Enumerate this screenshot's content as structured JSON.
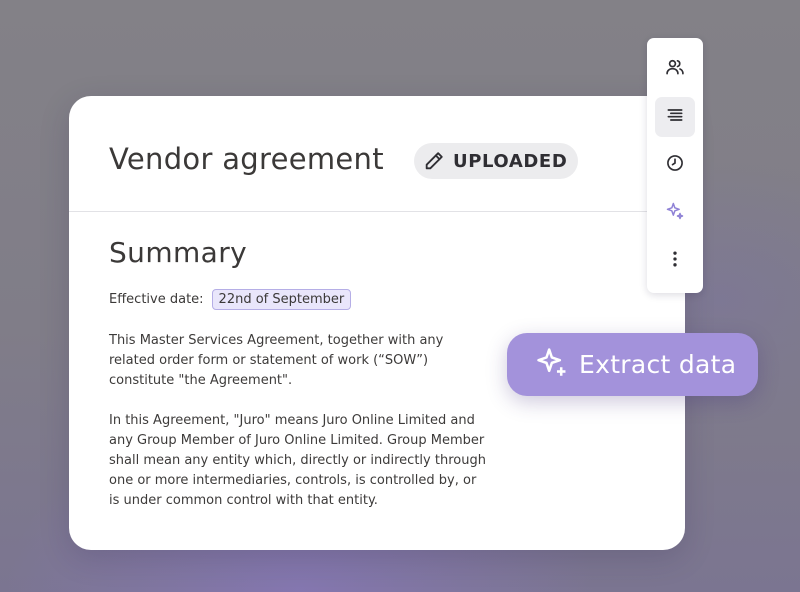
{
  "document": {
    "title": "Vendor agreement",
    "status": "UPLOADED",
    "status_icon": "pencil-icon"
  },
  "summary": {
    "heading": "Summary",
    "effective_date_label": "Effective date:",
    "effective_date_value": "22nd of September",
    "paragraphs": [
      "This Master Services Agreement,  together with any related order form or statement of work (“SOW”) constitute \"the Agreement\".",
      "In this Agreement, \"Juro\" means Juro Online Limited and any Group Member of Juro Online Limited. Group Member shall mean any entity which, directly or indirectly through one or more intermediaries, controls, is controlled by, or is under common control with that entity."
    ]
  },
  "toolbar": {
    "items": [
      {
        "icon": "people-icon",
        "active": false
      },
      {
        "icon": "text-lines-icon",
        "active": true
      },
      {
        "icon": "clock-icon",
        "active": false
      },
      {
        "icon": "sparkle-icon",
        "active": false
      },
      {
        "icon": "more-vertical-icon",
        "active": false
      }
    ]
  },
  "extract": {
    "label": "Extract data",
    "icon": "sparkle-icon"
  },
  "colors": {
    "accent": "#a392db",
    "sparkle": "#8f82d6",
    "date_chip_bg": "#e9e6fb",
    "date_chip_border": "#b5aee6",
    "text": "#3b3938"
  }
}
